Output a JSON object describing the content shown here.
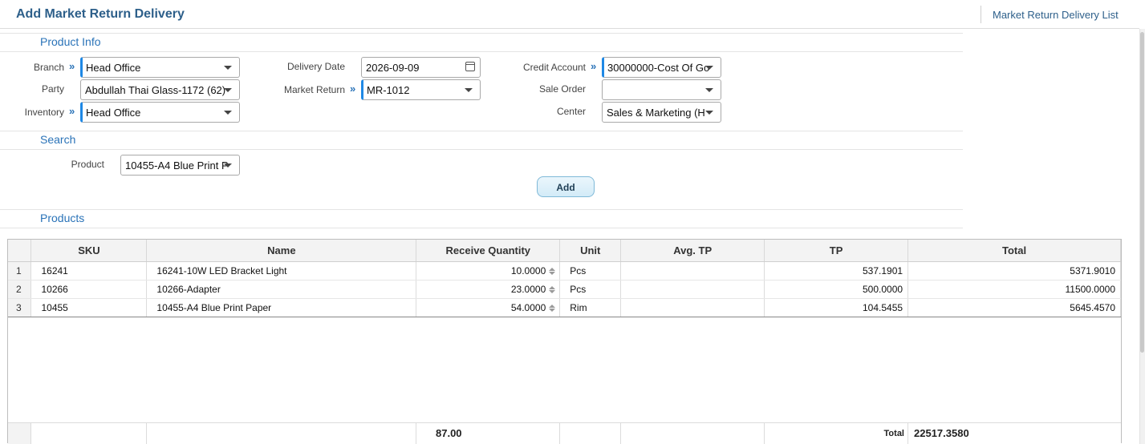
{
  "header": {
    "title": "Add Market Return Delivery",
    "list_link": "Market Return Delivery List"
  },
  "sections": {
    "product_info": "Product Info",
    "search": "Search",
    "products": "Products"
  },
  "form": {
    "branch": {
      "label": "Branch",
      "value": "Head Office"
    },
    "party": {
      "label": "Party",
      "value": "Abdullah Thai Glass-1172 (62)"
    },
    "inventory": {
      "label": "Inventory",
      "value": "Head Office"
    },
    "delivery_date": {
      "label": "Delivery Date",
      "value": "2026-09-09"
    },
    "market_return": {
      "label": "Market Return",
      "value": "MR-1012"
    },
    "credit_account": {
      "label": "Credit Account",
      "value": "30000000-Cost Of Go"
    },
    "sale_order": {
      "label": "Sale Order",
      "value": ""
    },
    "center": {
      "label": "Center",
      "value": "Sales & Marketing (H"
    },
    "product": {
      "label": "Product",
      "value": "10455-A4 Blue Print P"
    },
    "add_label": "Add"
  },
  "grid": {
    "columns": [
      "SKU",
      "Name",
      "Receive Quantity",
      "Unit",
      "Avg. TP",
      "TP",
      "Total"
    ],
    "rows": [
      {
        "idx": "1",
        "sku": "16241",
        "name": "16241-10W LED Bracket Light",
        "qty": "10.0000",
        "unit": "Pcs",
        "avg_tp": "",
        "tp": "537.1901",
        "total": "5371.9010"
      },
      {
        "idx": "2",
        "sku": "10266",
        "name": "10266-Adapter",
        "qty": "23.0000",
        "unit": "Pcs",
        "avg_tp": "",
        "tp": "500.0000",
        "total": "11500.0000"
      },
      {
        "idx": "3",
        "sku": "10455",
        "name": "10455-A4 Blue Print Paper",
        "qty": "54.0000",
        "unit": "Rim",
        "avg_tp": "",
        "tp": "104.5455",
        "total": "5645.4570"
      }
    ],
    "footer": {
      "qty_total": "87.00",
      "total_label": "Total",
      "grand_total": "22517.3580"
    }
  },
  "colors": {
    "accent": "#2a73b8",
    "required_marker": "#1e88e5",
    "title": "#2d5f8a"
  }
}
